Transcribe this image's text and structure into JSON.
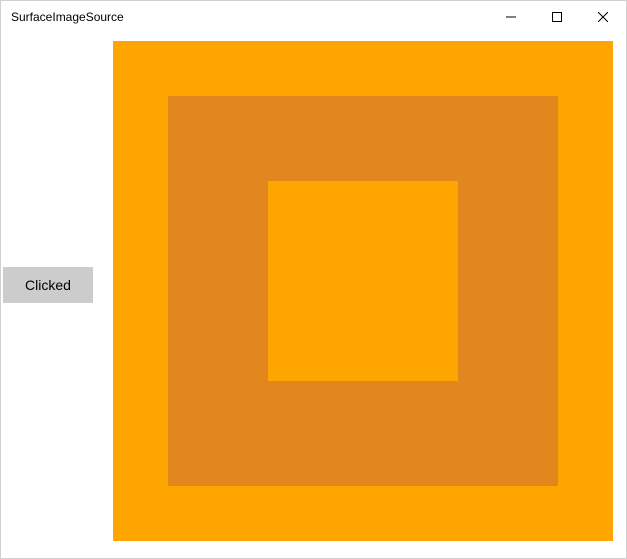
{
  "window": {
    "title": "SurfaceImageSource"
  },
  "button": {
    "label": "Clicked"
  },
  "canvas": {
    "colors": {
      "outer": "#ffa500",
      "middle": "#e2861e",
      "inner": "#ffa500"
    }
  }
}
